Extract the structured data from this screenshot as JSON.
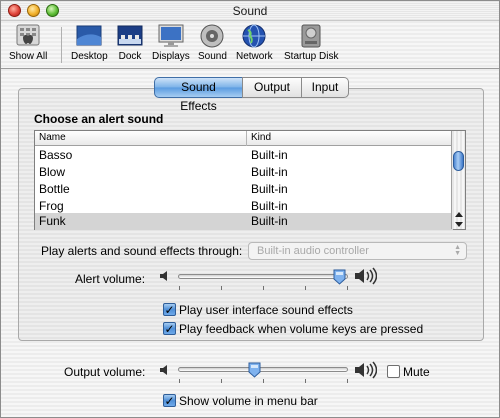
{
  "window": {
    "title": "Sound"
  },
  "toolbar": {
    "items": [
      {
        "label": "Show All",
        "icon": "apple-show-all-icon"
      },
      {
        "label": "Desktop",
        "icon": "desktop-icon"
      },
      {
        "label": "Dock",
        "icon": "dock-icon"
      },
      {
        "label": "Displays",
        "icon": "displays-icon"
      },
      {
        "label": "Sound",
        "icon": "speaker-icon"
      },
      {
        "label": "Network",
        "icon": "globe-icon"
      },
      {
        "label": "Startup Disk",
        "icon": "disk-icon"
      }
    ]
  },
  "tabs": [
    {
      "label": "Sound Effects",
      "active": true
    },
    {
      "label": "Output",
      "active": false
    },
    {
      "label": "Input",
      "active": false
    }
  ],
  "sound_effects": {
    "heading": "Choose an alert sound",
    "columns": {
      "name": "Name",
      "kind": "Kind"
    },
    "rows": [
      {
        "name": "Basso",
        "kind": "Built-in",
        "selected": false
      },
      {
        "name": "Blow",
        "kind": "Built-in",
        "selected": false
      },
      {
        "name": "Bottle",
        "kind": "Built-in",
        "selected": false
      },
      {
        "name": "Frog",
        "kind": "Built-in",
        "selected": false
      },
      {
        "name": "Funk",
        "kind": "Built-in",
        "selected": true
      }
    ],
    "play_through_label": "Play alerts and sound effects through:",
    "play_through_value": "Built-in audio controller",
    "alert_volume_label": "Alert volume:",
    "alert_volume_level": 0.95,
    "ui_sounds_label": "Play user interface sound effects",
    "ui_sounds_checked": true,
    "feedback_label": "Play feedback when volume keys are pressed",
    "feedback_checked": true
  },
  "output": {
    "output_volume_label": "Output volume:",
    "output_volume_level": 0.45,
    "mute_label": "Mute",
    "mute_checked": false,
    "menu_bar_label": "Show volume in menu bar",
    "menu_bar_checked": true
  },
  "colors": {
    "accent": "#5a9be0",
    "selection": "#d4d4d4"
  }
}
